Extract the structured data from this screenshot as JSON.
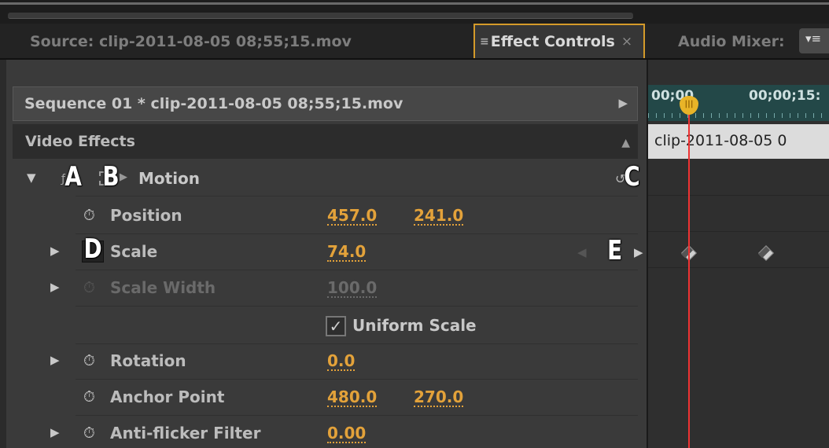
{
  "tabs": {
    "source": "Source: clip-2011-08-05 08;55;15.mov",
    "effect_controls": "Effect Controls",
    "effect_controls_close": "×",
    "audio_mixer": "Audio Mixer:",
    "menu_icon": "panel-menu-icon"
  },
  "sequence": {
    "title": "Sequence 01 * clip-2011-08-05 08;55;15.mov"
  },
  "video_effects": {
    "header": "Video Effects",
    "motion": {
      "label": "Motion",
      "properties": [
        {
          "label": "Position",
          "values": [
            "457.0",
            "241.0"
          ]
        },
        {
          "label": "Scale",
          "values": [
            "74.0"
          ]
        },
        {
          "label": "Scale Width",
          "values": [
            "100.0"
          ]
        },
        {
          "label": "Uniform Scale",
          "checked": true
        },
        {
          "label": "Rotation",
          "values": [
            "0.0"
          ]
        },
        {
          "label": "Anchor Point",
          "values": [
            "480.0",
            "270.0"
          ]
        },
        {
          "label": "Anti-flicker Filter",
          "values": [
            "0.00"
          ]
        }
      ]
    }
  },
  "callouts": [
    "A",
    "B",
    "C",
    "D",
    "E"
  ],
  "timeline": {
    "start_time": "00;00",
    "mark_time": "00;00;15:",
    "clip_name": "clip-2011-08-05 0"
  },
  "colors": {
    "value_orange": "#e3a23a",
    "tab_highlight": "#d49a2a",
    "playhead": "#e33333",
    "ruler_teal": "#234848"
  }
}
